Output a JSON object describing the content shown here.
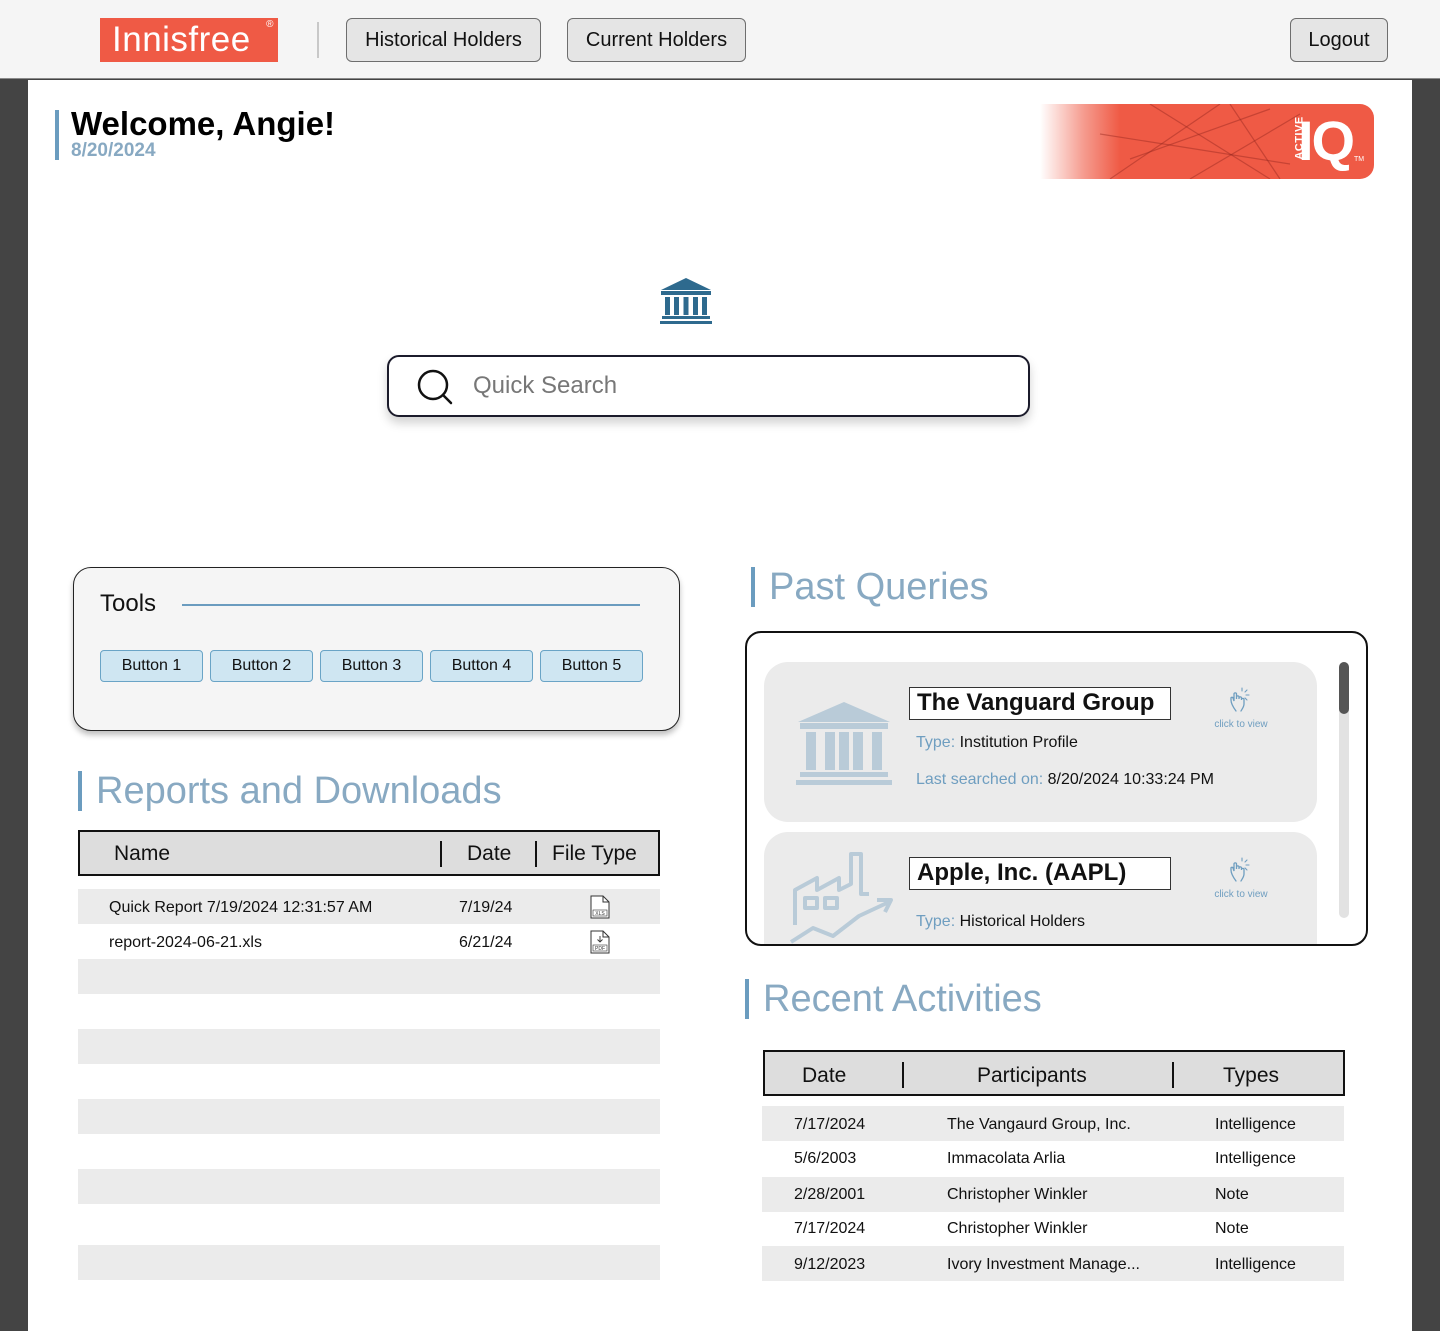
{
  "header": {
    "logo_text": "Innisfree",
    "logo_mark": "®",
    "nav": [
      "Historical Holders",
      "Current Holders"
    ],
    "logout_label": "Logout"
  },
  "welcome": {
    "title": "Welcome, Angie!",
    "date": "8/20/2024"
  },
  "banner": {
    "small": "ACTIVE",
    "big": "IQ",
    "tm": "TM"
  },
  "search": {
    "placeholder": "Quick Search",
    "icon": "search-icon",
    "top_icon": "bank-icon"
  },
  "tools": {
    "title": "Tools",
    "buttons": [
      "Button 1",
      "Button 2",
      "Button 3",
      "Button 4",
      "Button 5"
    ]
  },
  "reports": {
    "title": "Reports and Downloads",
    "columns": [
      "Name",
      "Date",
      "File Type"
    ],
    "rows": [
      {
        "name": "Quick Report 7/19/2024 12:31:57 AM",
        "date": "7/19/24",
        "file_type": "XLS"
      },
      {
        "name": "report-2024-06-21.xls",
        "date": "6/21/24",
        "file_type": "PDF"
      }
    ]
  },
  "past_queries": {
    "title": "Past Queries",
    "items": [
      {
        "name": "The Vanguard Group",
        "type_label": "Type:",
        "type": "Institution Profile",
        "searched_label": "Last searched on:",
        "searched": "8/20/2024 10:33:24 PM",
        "click": "click to view",
        "icon": "bank-icon"
      },
      {
        "name": "Apple, Inc. (AAPL)",
        "type_label": "Type:",
        "type": "Historical Holders",
        "click": "click to view",
        "icon": "factory-chart-icon"
      }
    ]
  },
  "recent_activities": {
    "title": "Recent Activities",
    "columns": [
      "Date",
      "Participants",
      "Types"
    ],
    "rows": [
      {
        "date": "7/17/2024",
        "participants": "The Vangaurd Group, Inc.",
        "type": "Intelligence"
      },
      {
        "date": "5/6/2003",
        "participants": "Immacolata Arlia",
        "type": "Intelligence"
      },
      {
        "date": "2/28/2001",
        "participants": "Christopher Winkler",
        "type": "Note"
      },
      {
        "date": "7/17/2024",
        "participants": "Christopher Winkler",
        "type": "Note"
      },
      {
        "date": "9/12/2023",
        "participants": "Ivory Investment Manage...",
        "type": "Intelligence"
      }
    ]
  },
  "colors": {
    "brand": "#ef5a45",
    "accent": "#6b9cbf",
    "accent_text": "#88a9c2",
    "icon_blue": "#2e6a8e"
  }
}
